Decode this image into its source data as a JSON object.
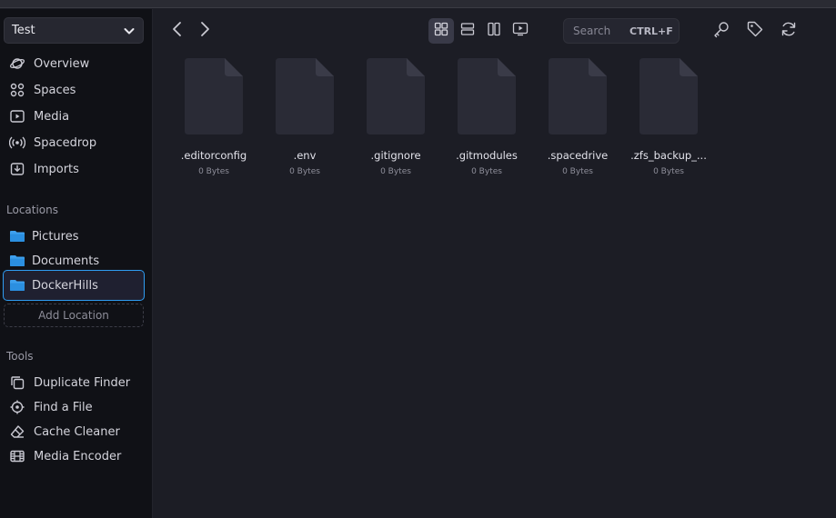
{
  "library": {
    "name": "Test"
  },
  "nav": [
    {
      "label": "Overview",
      "icon": "planet-icon"
    },
    {
      "label": "Spaces",
      "icon": "spaces-icon"
    },
    {
      "label": "Media",
      "icon": "media-icon"
    },
    {
      "label": "Spacedrop",
      "icon": "broadcast-icon"
    },
    {
      "label": "Imports",
      "icon": "import-icon"
    }
  ],
  "locations": {
    "heading": "Locations",
    "items": [
      {
        "label": "Pictures"
      },
      {
        "label": "Documents"
      },
      {
        "label": "DockerHills",
        "active": true
      }
    ],
    "add_label": "Add Location"
  },
  "tools": {
    "heading": "Tools",
    "items": [
      {
        "label": "Duplicate Finder",
        "icon": "copy-icon"
      },
      {
        "label": "Find a File",
        "icon": "crosshair-icon"
      },
      {
        "label": "Cache Cleaner",
        "icon": "eraser-icon"
      },
      {
        "label": "Media Encoder",
        "icon": "film-icon"
      }
    ]
  },
  "search": {
    "placeholder": "Search",
    "shortcut": "CTRL+F"
  },
  "files": [
    {
      "name": ".editorconfig",
      "size": "0 Bytes"
    },
    {
      "name": ".env",
      "size": "0 Bytes"
    },
    {
      "name": ".gitignore",
      "size": "0 Bytes"
    },
    {
      "name": ".gitmodules",
      "size": "0 Bytes"
    },
    {
      "name": ".spacedrive",
      "size": "0 Bytes"
    },
    {
      "name": ".zfs_backup_...",
      "size": "0 Bytes"
    }
  ],
  "colors": {
    "accent": "#2f9df2",
    "folder": "#3ea0ee",
    "background": "#1c1d25",
    "sidebar": "#101116"
  }
}
